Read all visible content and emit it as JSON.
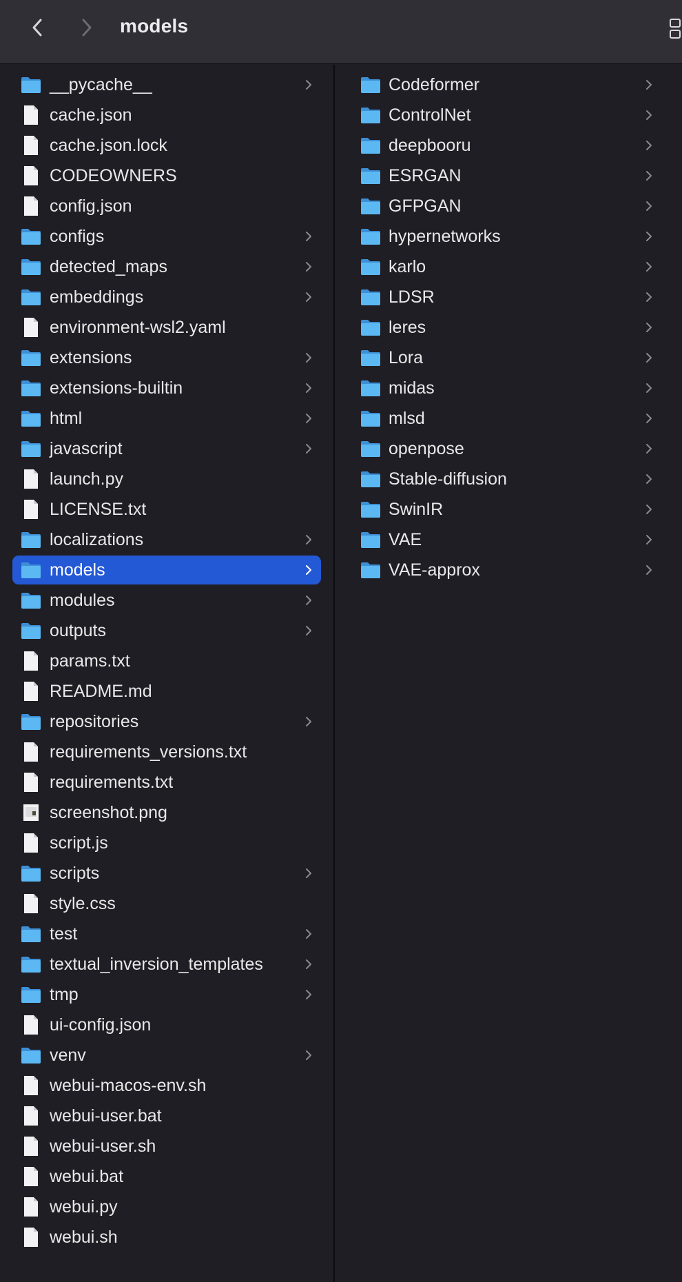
{
  "window": {
    "title": "models"
  },
  "left_column": {
    "items": [
      {
        "label": "__pycache__",
        "kind": "folder",
        "icon": "folder-icon"
      },
      {
        "label": "cache.json",
        "kind": "file",
        "icon": "file-icon"
      },
      {
        "label": "cache.json.lock",
        "kind": "file",
        "icon": "file-icon"
      },
      {
        "label": "CODEOWNERS",
        "kind": "file",
        "icon": "file-icon"
      },
      {
        "label": "config.json",
        "kind": "file",
        "icon": "file-icon"
      },
      {
        "label": "configs",
        "kind": "folder",
        "icon": "folder-icon"
      },
      {
        "label": "detected_maps",
        "kind": "folder",
        "icon": "folder-icon"
      },
      {
        "label": "embeddings",
        "kind": "folder",
        "icon": "folder-icon"
      },
      {
        "label": "environment-wsl2.yaml",
        "kind": "file",
        "icon": "file-icon"
      },
      {
        "label": "extensions",
        "kind": "folder",
        "icon": "folder-icon"
      },
      {
        "label": "extensions-builtin",
        "kind": "folder",
        "icon": "folder-icon"
      },
      {
        "label": "html",
        "kind": "folder",
        "icon": "folder-icon"
      },
      {
        "label": "javascript",
        "kind": "folder",
        "icon": "folder-icon"
      },
      {
        "label": "launch.py",
        "kind": "file",
        "icon": "file-icon"
      },
      {
        "label": "LICENSE.txt",
        "kind": "file",
        "icon": "file-icon"
      },
      {
        "label": "localizations",
        "kind": "folder",
        "icon": "folder-icon"
      },
      {
        "label": "models",
        "kind": "folder",
        "icon": "folder-icon",
        "selected": true
      },
      {
        "label": "modules",
        "kind": "folder",
        "icon": "folder-icon"
      },
      {
        "label": "outputs",
        "kind": "folder",
        "icon": "folder-icon"
      },
      {
        "label": "params.txt",
        "kind": "file",
        "icon": "file-icon"
      },
      {
        "label": "README.md",
        "kind": "file",
        "icon": "file-icon"
      },
      {
        "label": "repositories",
        "kind": "folder",
        "icon": "folder-icon"
      },
      {
        "label": "requirements_versions.txt",
        "kind": "file",
        "icon": "file-icon"
      },
      {
        "label": "requirements.txt",
        "kind": "file",
        "icon": "file-icon"
      },
      {
        "label": "screenshot.png",
        "kind": "image",
        "icon": "image-file-icon"
      },
      {
        "label": "script.js",
        "kind": "file",
        "icon": "file-icon"
      },
      {
        "label": "scripts",
        "kind": "folder",
        "icon": "folder-icon"
      },
      {
        "label": "style.css",
        "kind": "file",
        "icon": "file-icon"
      },
      {
        "label": "test",
        "kind": "folder",
        "icon": "folder-icon"
      },
      {
        "label": "textual_inversion_templates",
        "kind": "folder",
        "icon": "folder-icon"
      },
      {
        "label": "tmp",
        "kind": "folder",
        "icon": "folder-icon"
      },
      {
        "label": "ui-config.json",
        "kind": "file",
        "icon": "file-icon"
      },
      {
        "label": "venv",
        "kind": "folder",
        "icon": "folder-icon"
      },
      {
        "label": "webui-macos-env.sh",
        "kind": "file",
        "icon": "file-icon"
      },
      {
        "label": "webui-user.bat",
        "kind": "file",
        "icon": "file-icon"
      },
      {
        "label": "webui-user.sh",
        "kind": "file",
        "icon": "file-icon"
      },
      {
        "label": "webui.bat",
        "kind": "file",
        "icon": "file-icon"
      },
      {
        "label": "webui.py",
        "kind": "file",
        "icon": "file-icon"
      },
      {
        "label": "webui.sh",
        "kind": "file",
        "icon": "file-icon"
      }
    ]
  },
  "right_column": {
    "items": [
      {
        "label": "Codeformer",
        "kind": "folder",
        "icon": "folder-icon"
      },
      {
        "label": "ControlNet",
        "kind": "folder",
        "icon": "folder-icon"
      },
      {
        "label": "deepbooru",
        "kind": "folder",
        "icon": "folder-icon"
      },
      {
        "label": "ESRGAN",
        "kind": "folder",
        "icon": "folder-icon"
      },
      {
        "label": "GFPGAN",
        "kind": "folder",
        "icon": "folder-icon"
      },
      {
        "label": "hypernetworks",
        "kind": "folder",
        "icon": "folder-icon"
      },
      {
        "label": "karlo",
        "kind": "folder",
        "icon": "folder-icon"
      },
      {
        "label": "LDSR",
        "kind": "folder",
        "icon": "folder-icon"
      },
      {
        "label": "leres",
        "kind": "folder",
        "icon": "folder-icon"
      },
      {
        "label": "Lora",
        "kind": "folder",
        "icon": "folder-icon"
      },
      {
        "label": "midas",
        "kind": "folder",
        "icon": "folder-icon"
      },
      {
        "label": "mlsd",
        "kind": "folder",
        "icon": "folder-icon"
      },
      {
        "label": "openpose",
        "kind": "folder",
        "icon": "folder-icon"
      },
      {
        "label": "Stable-diffusion",
        "kind": "folder",
        "icon": "folder-icon"
      },
      {
        "label": "SwinIR",
        "kind": "folder",
        "icon": "folder-icon"
      },
      {
        "label": "VAE",
        "kind": "folder",
        "icon": "folder-icon"
      },
      {
        "label": "VAE-approx",
        "kind": "folder",
        "icon": "folder-icon"
      }
    ]
  },
  "colors": {
    "selection": "#2459d5",
    "folder": "#5ab6f0",
    "text": "#e8e8ea",
    "toolbar": "#312f36",
    "background": "#1f1e24"
  }
}
